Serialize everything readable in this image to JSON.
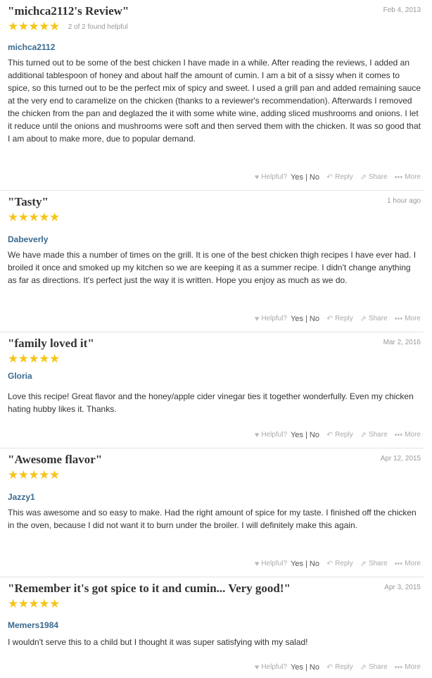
{
  "reviews": [
    {
      "title": "\"michca2112's Review\"",
      "date": "Feb 4, 2013",
      "stars": "★★★★★",
      "helpful_count": "2 of 2 found helpful",
      "author": "michca2112",
      "text": "This turned out to be some of the best chicken I have made in a while. After reading the reviews, I added an additional tablespoon of honey and about half the amount of cumin. I am a bit of a sissy when it comes to spice, so this turned out to be the perfect mix of spicy and sweet. I used a grill pan and added remaining sauce at the very end to caramelize on the chicken (thanks to a reviewer's recommendation). Afterwards I removed the chicken from the pan and deglazed the it with some white wine, adding sliced mushrooms and onions. I let it reduce until the onions and mushrooms were soft and then served them with the chicken. It was so good that I am about to make more, due to popular demand."
    },
    {
      "title": "\"Tasty\"",
      "date": "1 hour ago",
      "stars": "★★★★★",
      "author": "Dabeverly",
      "text": "We have made this a number of times on the grill. It is one of the best chicken thigh recipes I have ever had. I broiled it once and smoked up my kitchen so we are keeping it as a summer recipe. I didn't change anything as far as directions. It's perfect just the way it is written. Hope you enjoy as much as we do."
    },
    {
      "title": "\"family loved it\"",
      "date": "Mar 2, 2016",
      "stars": "★★★★★",
      "author": "Gloria",
      "text": "Love this recipe! Great flavor and the honey/apple cider vinegar ties it together wonderfully. Even my chicken hating hubby likes it. Thanks."
    },
    {
      "title": "\"Awesome flavor\"",
      "date": "Apr 12, 2015",
      "stars": "★★★★★",
      "author": "Jazzy1",
      "text": "This was awesome and so easy to make. Had the right amount of spice for my taste. I finished off the chicken in the oven, because I did not want it to burn under the broiler. I will definitely make this again."
    },
    {
      "title": "\"Remember it's got spice to it and cumin... Very good!\"",
      "date": "Apr 3, 2015",
      "stars": "★★★★★",
      "author": "Memers1984",
      "text": "I wouldn't serve this to a child but I thought it was super satisfying with my salad!"
    }
  ],
  "actions": {
    "helpful_label": "Helpful?",
    "yes": "Yes",
    "separator": "|",
    "no": "No",
    "reply": "Reply",
    "share": "Share",
    "more": "More"
  },
  "icons": {
    "heart": "♥",
    "reply": "↶",
    "share": "⇗",
    "more": "•••"
  },
  "colors": {
    "star": "#f5c518",
    "author": "#3a6a8f"
  }
}
